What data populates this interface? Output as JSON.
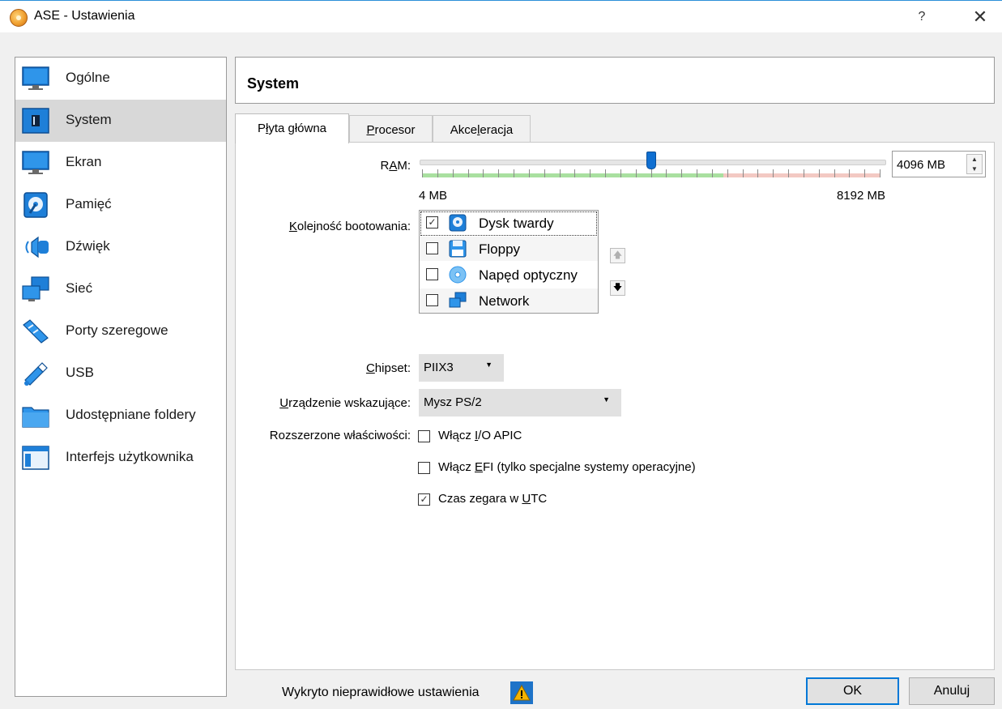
{
  "window": {
    "title": "ASE - Ustawienia",
    "help_label": "?",
    "close_label": "✕"
  },
  "sidebar": {
    "items": [
      {
        "label": "Ogólne",
        "icon": "monitor-icon"
      },
      {
        "label": "System",
        "icon": "chip-icon"
      },
      {
        "label": "Ekran",
        "icon": "display-icon"
      },
      {
        "label": "Pamięć",
        "icon": "hard-disk-icon"
      },
      {
        "label": "Dźwięk",
        "icon": "speaker-icon"
      },
      {
        "label": "Sieć",
        "icon": "network-icon"
      },
      {
        "label": "Porty szeregowe",
        "icon": "serial-cable-icon"
      },
      {
        "label": "USB",
        "icon": "usb-icon"
      },
      {
        "label": "Udostępniane foldery",
        "icon": "folder-icon"
      },
      {
        "label": "Interfejs użytkownika",
        "icon": "window-layout-icon"
      }
    ],
    "selected": "System"
  },
  "header": {
    "title": "System"
  },
  "tabs": [
    {
      "label_pre": "P",
      "label_u": "ł",
      "label_post": "yta główna"
    },
    {
      "label_pre": "",
      "label_u": "P",
      "label_post": "rocesor"
    },
    {
      "label_pre": "Akce",
      "label_u": "l",
      "label_post": "eracja"
    }
  ],
  "motherboard": {
    "ram": {
      "label_pre": "R",
      "label_u": "A",
      "label_post": "M:",
      "min_label": "4 MB",
      "max_label": "8192 MB",
      "value": "4096 MB",
      "value_fraction": 0.5
    },
    "boot_order": {
      "label_pre": "",
      "label_u": "K",
      "label_post": "olejność bootowania:",
      "items": [
        {
          "label": "Dysk twardy",
          "checked": true,
          "icon": "hard-disk-icon"
        },
        {
          "label": "Floppy",
          "checked": false,
          "icon": "floppy-icon"
        },
        {
          "label": "Napęd optyczny",
          "checked": false,
          "icon": "optical-disc-icon"
        },
        {
          "label": "Network",
          "checked": false,
          "icon": "network-icon"
        }
      ]
    },
    "chipset": {
      "label_pre": "",
      "label_u": "C",
      "label_post": "hipset:",
      "value": "PIIX3"
    },
    "pointing_device": {
      "label_pre": "",
      "label_u": "U",
      "label_post": "rządzenie wskazujące:",
      "value": "Mysz PS/2"
    },
    "extended": {
      "label": "Rozszerzone właściwości:",
      "options": [
        {
          "label_pre": "Włącz ",
          "label_u": "I",
          "label_post": "/O APIC",
          "checked": false
        },
        {
          "label_pre": "Włącz ",
          "label_u": "E",
          "label_post": "FI (tylko specjalne systemy operacyjne)",
          "checked": false
        },
        {
          "label_pre": "Czas zegara w ",
          "label_u": "U",
          "label_post": "TC",
          "checked": true
        }
      ]
    }
  },
  "footer": {
    "status": "Wykryto nieprawidłowe ustawienia",
    "ok_label": "OK",
    "cancel_label": "Anuluj"
  },
  "colors": {
    "accent": "#0f6fd1",
    "ram_safe": "#a9e0a0",
    "ram_warn": "#f3c9c3"
  }
}
